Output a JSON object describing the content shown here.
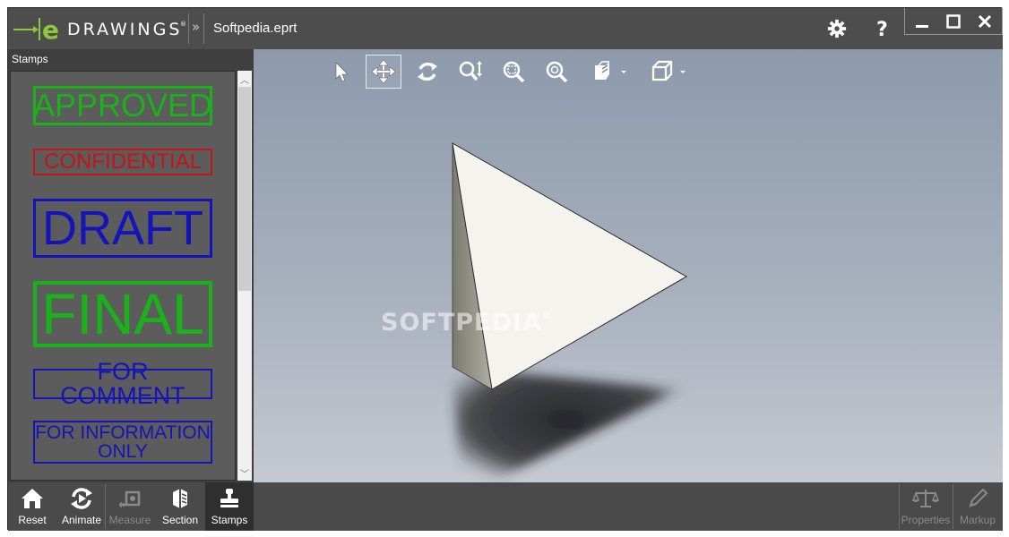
{
  "app": {
    "logo_text": "DRAWINGS",
    "logo_reg": "®",
    "document_title": "Softpedia.eprt"
  },
  "titlebar": {
    "chevron": "»"
  },
  "panel": {
    "title": "Stamps",
    "stamps": [
      {
        "label": "APPROVED",
        "color": "#1bb11b"
      },
      {
        "label": "CONFIDENTIAL",
        "color": "#c41414"
      },
      {
        "label": "DRAFT",
        "color": "#1414b8"
      },
      {
        "label": "FINAL",
        "color": "#1bb11b"
      },
      {
        "label": "FOR COMMENT",
        "color": "#1414b8"
      },
      {
        "label_line1": "FOR INFORMATION",
        "label_line2": "ONLY",
        "color": "#1414b8"
      }
    ]
  },
  "viewport": {
    "watermark": "SOFTPEDIA",
    "watermark_reg": "®",
    "tools": [
      "select-icon",
      "pan-icon",
      "rotate-icon",
      "zoom-icon",
      "zoom-fit-icon",
      "zoom-area-icon",
      "views-icon",
      "display-style-icon"
    ]
  },
  "bottombar": {
    "left": [
      {
        "label": "Reset",
        "icon": "home-icon"
      },
      {
        "label": "Animate",
        "icon": "animate-icon"
      },
      {
        "label": "Measure",
        "icon": "measure-icon",
        "disabled": true
      },
      {
        "label": "Section",
        "icon": "section-icon"
      },
      {
        "label": "Stamps",
        "icon": "stamp-icon",
        "active": true
      }
    ],
    "right": [
      {
        "label": "Properties",
        "icon": "scales-icon",
        "disabled": true
      },
      {
        "label": "Markup",
        "icon": "pencil-icon",
        "disabled": true
      }
    ]
  },
  "colors": {
    "accent_green": "#8dc63f",
    "panel_bg": "#3f3f3f",
    "toolbar_bg": "#4a4a4a"
  }
}
